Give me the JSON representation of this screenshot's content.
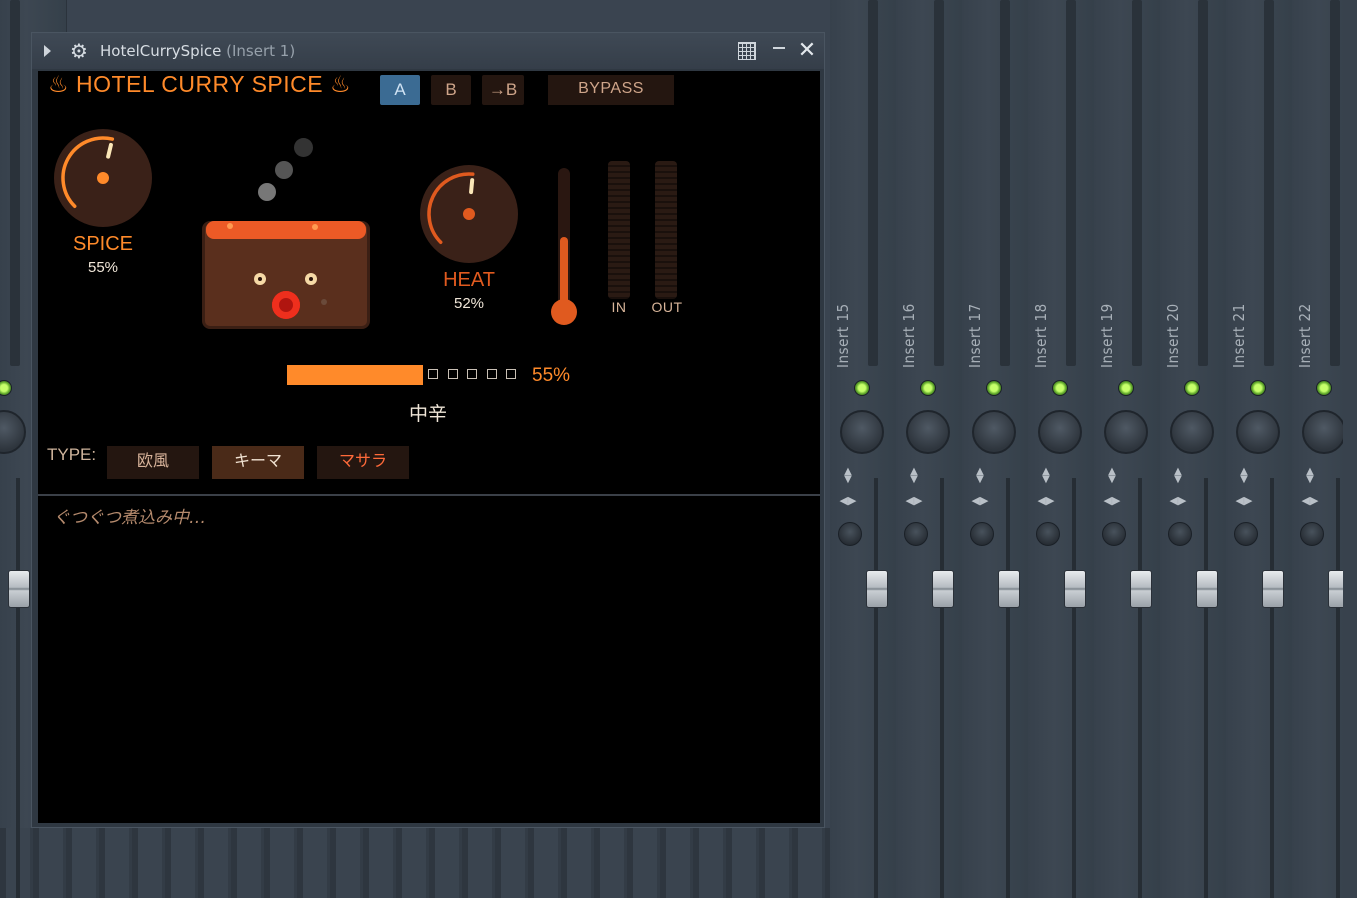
{
  "window": {
    "title": "HotelCurrySpice",
    "subtitle": "(Insert 1)"
  },
  "plugin": {
    "brand": "♨ HOTEL CURRY SPICE ♨",
    "presets": [
      "A",
      "B",
      "→B"
    ],
    "active_preset": "A",
    "bypass_label": "BYPASS",
    "spice": {
      "label": "SPICE",
      "value": "55%",
      "level": 0.55
    },
    "heat": {
      "label": "HEAT",
      "value": "52%",
      "level": 0.52
    },
    "thermometer_level": 0.52,
    "meters": {
      "in": "IN",
      "out": "OUT"
    },
    "spice_bar": {
      "level": 0.55,
      "percent": "55%",
      "empty_boxes": 5
    },
    "spice_level_name": "中辛",
    "type_label": "TYPE:",
    "types": [
      "欧風",
      "キーマ",
      "マサラ"
    ],
    "active_type": "キーマ",
    "status": "ぐつぐつ煮込み中…"
  },
  "colors": {
    "accent": "#ff8a2a",
    "heat": "#e05a1f",
    "pot": "#5a2f1d",
    "active_preset": "#3b6b93",
    "led": "#8be23a"
  },
  "mixer": {
    "tracks": [
      "Insert 15",
      "Insert 16",
      "Insert 17",
      "Insert 18",
      "Insert 19",
      "Insert 20",
      "Insert 21",
      "Insert 22"
    ]
  }
}
